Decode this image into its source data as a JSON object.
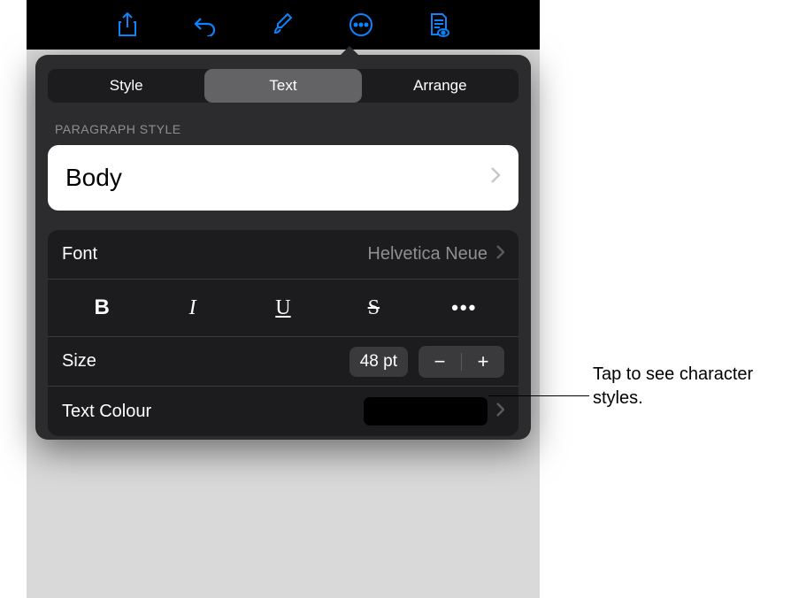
{
  "toolbar": {
    "icons": [
      "share",
      "undo",
      "format-brush",
      "more",
      "document-view"
    ]
  },
  "tabs": {
    "items": [
      {
        "label": "Style"
      },
      {
        "label": "Text"
      },
      {
        "label": "Arrange"
      }
    ],
    "selected": 1
  },
  "paragraph_section": {
    "label": "PARAGRAPH STYLE",
    "current": "Body"
  },
  "font_row": {
    "label": "Font",
    "value": "Helvetica Neue"
  },
  "format_buttons": {
    "bold": "B",
    "italic": "I",
    "underline": "U",
    "strike": "S",
    "more": "•••"
  },
  "size_row": {
    "label": "Size",
    "value": "48 pt",
    "minus": "−",
    "plus": "+"
  },
  "color_row": {
    "label": "Text Colour",
    "swatch": "#000000"
  },
  "callout": {
    "text": "Tap to see character styles."
  }
}
